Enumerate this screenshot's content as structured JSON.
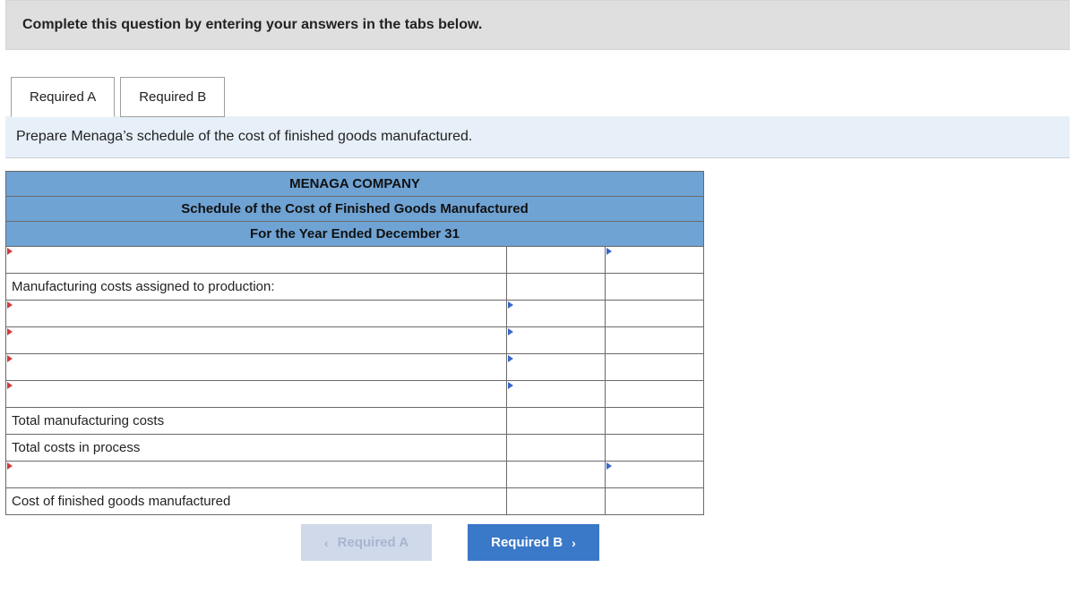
{
  "banner": "Complete this question by entering your answers in the tabs below.",
  "tabs": {
    "a": "Required A",
    "b": "Required B"
  },
  "prompt": "Prepare Menaga’s schedule of the cost of finished goods manufactured.",
  "header": {
    "company": "MENAGA COMPANY",
    "title": "Schedule of the Cost of Finished Goods Manufactured",
    "period": "For the Year Ended December 31"
  },
  "rows": {
    "section": "Manufacturing costs assigned to production:",
    "total_mfg": "Total manufacturing costs",
    "total_proc": "Total costs in process",
    "cost_finished": "Cost of finished goods manufactured"
  },
  "nav": {
    "prev": "Required A",
    "next": "Required B"
  }
}
